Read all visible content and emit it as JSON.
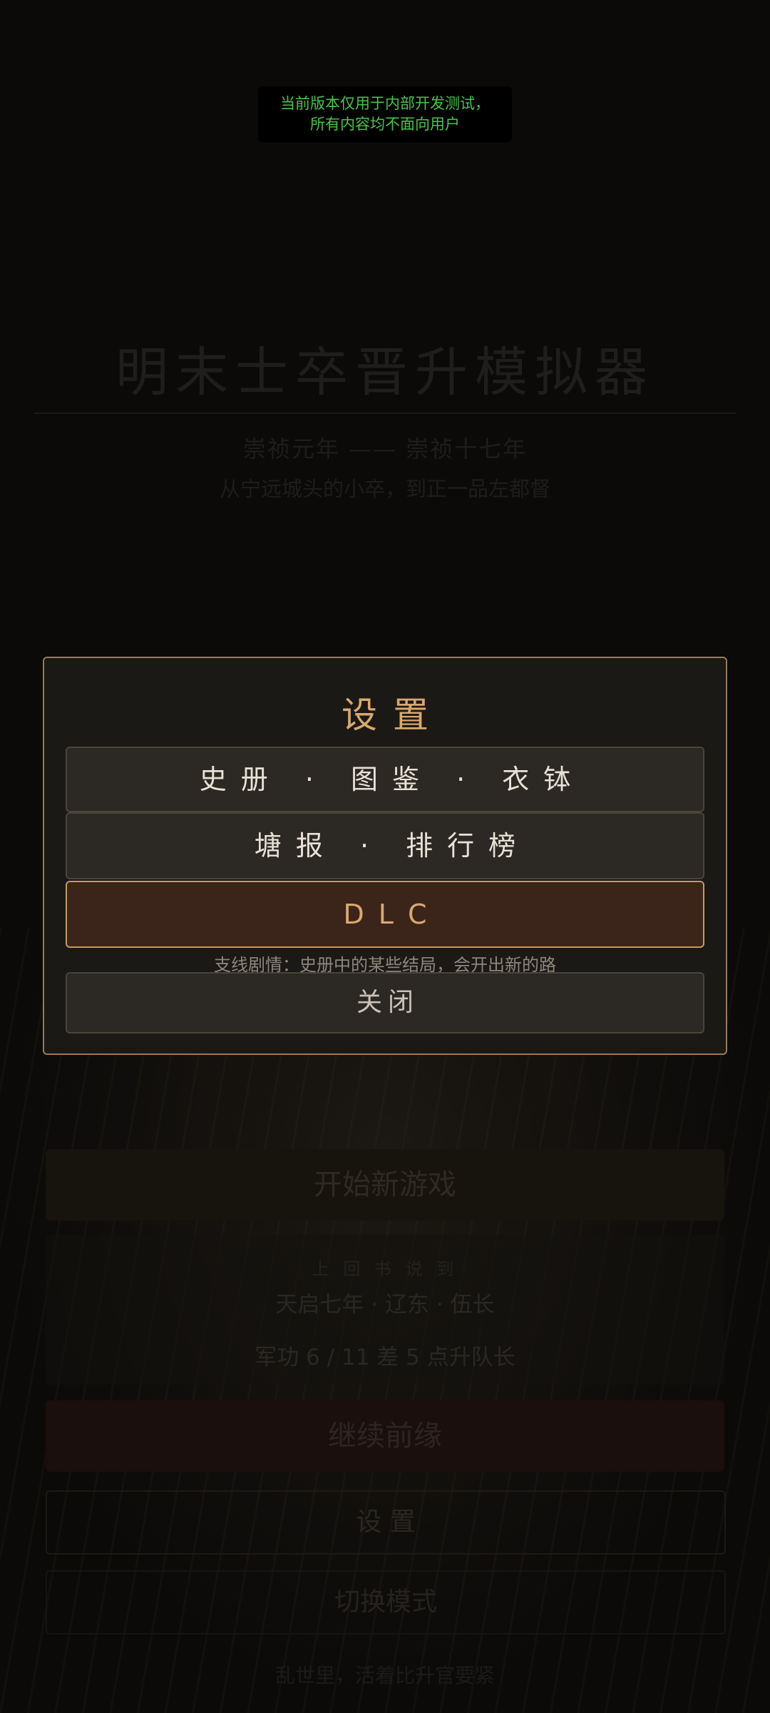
{
  "dev_notice": {
    "line1": "当前版本仅用于内部开发测试，",
    "line2": "所有内容均不面向用户"
  },
  "main_menu": {
    "title": "明末士卒晋升模拟器",
    "era": "崇祯元年 —— 崇祯十七年",
    "tagline": "从宁远城头的小卒，到正一品左都督",
    "new_game_label": "开始新游戏",
    "save_card": {
      "label": "上 回 书 说 到",
      "info": "天启七年 · 辽东 · 伍长",
      "progress": "军功 6 / 11   差 5 点升队长"
    },
    "continue_label": "继续前缘",
    "settings_label": "设 置",
    "switch_mode_label": "切换模式",
    "footer": "乱世里，活着比升官要紧"
  },
  "settings_modal": {
    "title": "设置",
    "archives_label": "史册 · 图鉴 · 衣钵",
    "news_label": "塘报 · 排行榜",
    "dlc_label": "DLC",
    "dlc_caption": "支线剧情：史册中的某些结局，会开出新的路",
    "close_label": "关闭"
  },
  "colors": {
    "accent_gold": "#d9a870",
    "modal_border": "#9a7a4f",
    "dlc_bg": "#3b2419",
    "notice_green": "#4cc24c"
  }
}
